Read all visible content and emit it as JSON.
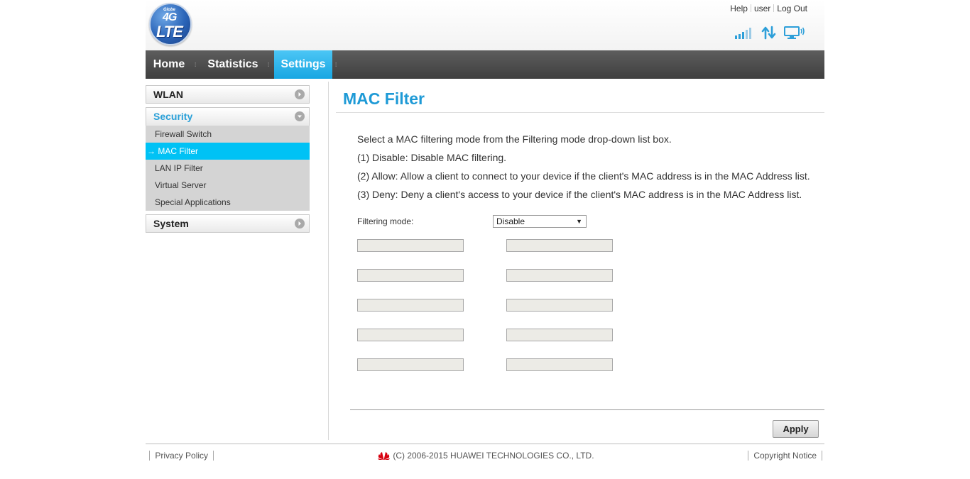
{
  "header": {
    "logo": {
      "line1": "Globe",
      "line2": "4G",
      "line3": "LTE"
    },
    "links": {
      "help": "Help",
      "user": "user",
      "logout": "Log Out"
    },
    "icons": [
      "signal-strength-icon",
      "data-transfer-icon",
      "connected-device-icon"
    ]
  },
  "nav": {
    "tabs": [
      {
        "label": "Home"
      },
      {
        "label": "Statistics"
      },
      {
        "label": "Settings"
      }
    ],
    "active_tab": "Settings"
  },
  "sidebar": {
    "groups": [
      {
        "label": "WLAN",
        "expanded": false
      },
      {
        "label": "Security",
        "expanded": true
      },
      {
        "label": "System",
        "expanded": false
      }
    ],
    "security_items": [
      {
        "label": "Firewall Switch"
      },
      {
        "label": "MAC Filter",
        "active_prefix": "→"
      },
      {
        "label": "LAN IP Filter"
      },
      {
        "label": "Virtual Server"
      },
      {
        "label": "Special Applications"
      }
    ]
  },
  "main": {
    "title": "MAC Filter",
    "description": [
      "Select a MAC filtering mode from the Filtering mode drop-down list box.",
      "(1) Disable: Disable MAC filtering.",
      "(2) Allow: Allow a client to connect to your device if the client's MAC address is in the MAC Address list.",
      "(3) Deny: Deny a client's access to your device if the client's MAC address is in the MAC Address list."
    ],
    "filtering_mode_label": "Filtering mode:",
    "filtering_mode_value": "Disable",
    "mac_addresses": [
      "",
      "",
      "",
      "",
      "",
      "",
      "",
      "",
      "",
      ""
    ],
    "apply_label": "Apply"
  },
  "footer": {
    "privacy": "Privacy Policy",
    "copyright": "(C) 2006-2015 HUAWEI TECHNOLOGIES CO., LTD.",
    "notice": "Copyright Notice"
  },
  "colors": {
    "accent": "#1e9ad6",
    "active_menu": "#00c2f5",
    "nav_bg": "#4a4a4a",
    "huawei_red": "#d7000f"
  }
}
